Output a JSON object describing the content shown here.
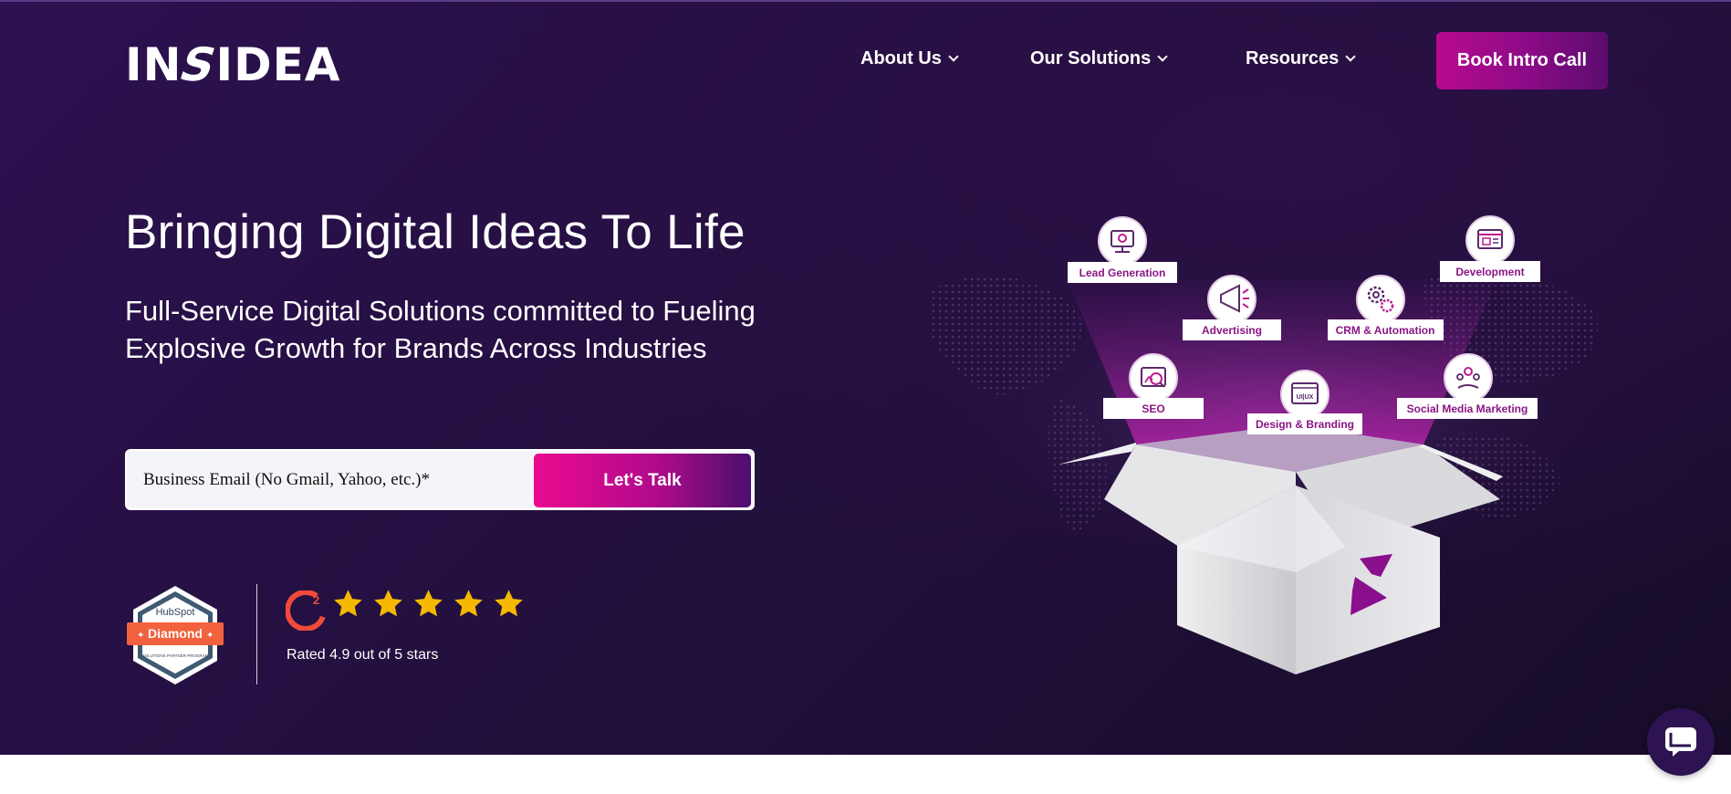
{
  "header": {
    "logo_text_left": "IN",
    "logo_text_s": "S",
    "logo_text_right": "IDEA",
    "nav": [
      {
        "label": "About Us"
      },
      {
        "label": "Our Solutions"
      },
      {
        "label": "Resources"
      }
    ],
    "cta_label": "Book Intro Call"
  },
  "hero": {
    "title": "Bringing Digital Ideas To Life",
    "subtitle": "Full-Service Digital Solutions committed to Fueling Explosive Growth for Brands Across Industries",
    "email_placeholder": "Business Email (No Gmail, Yahoo, etc.)*",
    "submit_label": "Let's Talk"
  },
  "trust": {
    "hubspot_brand": "HubSpot",
    "hubspot_tier": "Diamond",
    "hubspot_program": "SOLUTIONS PARTNER PROGRAM",
    "g2_logo": "G2",
    "rating_stars": 5,
    "rating_text": "Rated 4.9 out of 5 stars"
  },
  "services": [
    {
      "label": "Lead Generation",
      "icon": "monitor-gear-icon"
    },
    {
      "label": "Development",
      "icon": "browser-code-icon"
    },
    {
      "label": "Advertising",
      "icon": "megaphone-icon"
    },
    {
      "label": "CRM & Automation",
      "icon": "gears-icon"
    },
    {
      "label": "SEO",
      "icon": "chart-search-icon"
    },
    {
      "label": "Design & Branding",
      "icon": "ui-ux-icon"
    },
    {
      "label": "Social Media Marketing",
      "icon": "hand-share-icon"
    }
  ],
  "box_icon_letter": "S",
  "ui_ux_text": "UI|UX",
  "colors": {
    "hero_bg": "#23103f",
    "accent_pink": "#ea0a8f",
    "accent_purple": "#4b0f6e",
    "star_gold": "#f5b800",
    "hubspot_orange": "#f2623e"
  }
}
